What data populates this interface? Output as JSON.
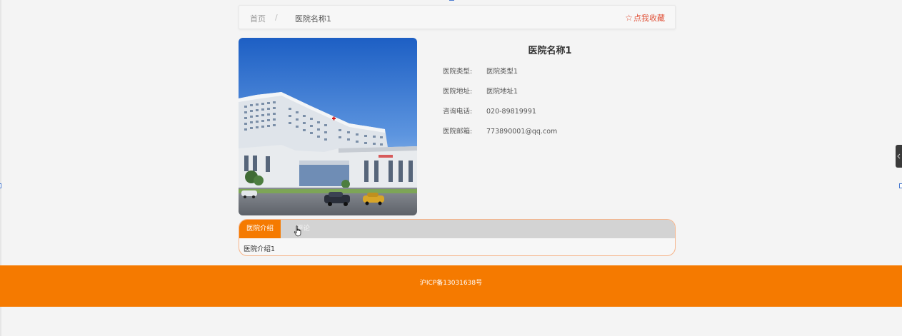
{
  "breadcrumb": {
    "home": "首页",
    "separator": "/",
    "current": "医院名称1"
  },
  "favorite": {
    "label": "点我收藏",
    "icon": "star-outline-icon",
    "color": "#e0533a"
  },
  "hospital": {
    "name": "医院名称1",
    "fields": [
      {
        "label": "医院类型:",
        "value": "医院类型1"
      },
      {
        "label": "医院地址:",
        "value": "医院地址1"
      },
      {
        "label": "咨询电话:",
        "value": "020-89819991"
      },
      {
        "label": "医院邮箱:",
        "value": "773890001@qq.com"
      }
    ]
  },
  "tabs": {
    "active_label": "医院介绍",
    "inactive_label": "评论",
    "content": "医院介绍1"
  },
  "footer": {
    "icp": "沪ICP备13031638号"
  },
  "colors": {
    "accent": "#f57a00",
    "tab_strip": "#d3d3d3",
    "page_bg": "#f4f4f4"
  }
}
